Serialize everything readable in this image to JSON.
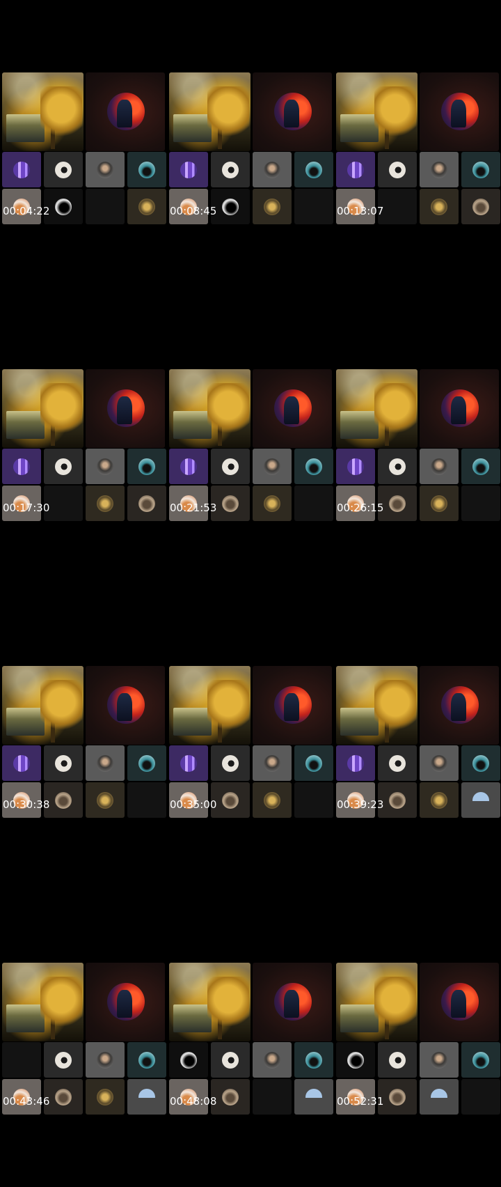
{
  "frames": [
    {
      "timestamp": "00:04:22",
      "tiles": [
        "t-purple",
        "t-white",
        "t-gray",
        "t-teal",
        "t-orange",
        "t-dark",
        "t-empty",
        "t-gold"
      ]
    },
    {
      "timestamp": "00:08:45",
      "tiles": [
        "t-purple",
        "t-white",
        "t-gray",
        "t-teal",
        "t-orange",
        "t-dark",
        "t-gold",
        "t-empty"
      ]
    },
    {
      "timestamp": "00:13:07",
      "tiles": [
        "t-purple",
        "t-white",
        "t-gray",
        "t-teal",
        "t-orange",
        "t-empty",
        "t-gold",
        "t-brown"
      ]
    },
    {
      "timestamp": "00:17:30",
      "tiles": [
        "t-purple",
        "t-white",
        "t-gray",
        "t-teal",
        "t-orange",
        "t-empty",
        "t-gold",
        "t-brown"
      ]
    },
    {
      "timestamp": "00:21:53",
      "tiles": [
        "t-purple",
        "t-white",
        "t-gray",
        "t-teal",
        "t-orange",
        "t-brown",
        "t-gold",
        "t-empty"
      ]
    },
    {
      "timestamp": "00:26:15",
      "tiles": [
        "t-purple",
        "t-white",
        "t-gray",
        "t-teal",
        "t-orange",
        "t-brown",
        "t-gold",
        "t-empty"
      ]
    },
    {
      "timestamp": "00:30:38",
      "tiles": [
        "t-purple",
        "t-white",
        "t-gray",
        "t-teal",
        "t-orange",
        "t-brown",
        "t-gold",
        "t-empty"
      ]
    },
    {
      "timestamp": "00:35:00",
      "tiles": [
        "t-purple",
        "t-white",
        "t-gray",
        "t-teal",
        "t-orange",
        "t-brown",
        "t-gold",
        "t-empty"
      ]
    },
    {
      "timestamp": "00:39:23",
      "tiles": [
        "t-purple",
        "t-white",
        "t-gray",
        "t-teal",
        "t-orange",
        "t-brown",
        "t-gold",
        "t-sky"
      ]
    },
    {
      "timestamp": "00:43:46",
      "tiles": [
        "t-empty",
        "t-white",
        "t-gray",
        "t-teal",
        "t-orange",
        "t-brown",
        "t-gold",
        "t-sky"
      ]
    },
    {
      "timestamp": "00:48:08",
      "tiles": [
        "t-dark",
        "t-white",
        "t-gray",
        "t-teal",
        "t-orange",
        "t-brown",
        "t-empty",
        "t-sky"
      ]
    },
    {
      "timestamp": "00:52:31",
      "tiles": [
        "t-dark",
        "t-white",
        "t-gray",
        "t-teal",
        "t-orange",
        "t-brown",
        "t-sky",
        "t-empty"
      ]
    }
  ],
  "colors": {
    "background": "#000000",
    "timestamp_text": "#ffffff"
  }
}
